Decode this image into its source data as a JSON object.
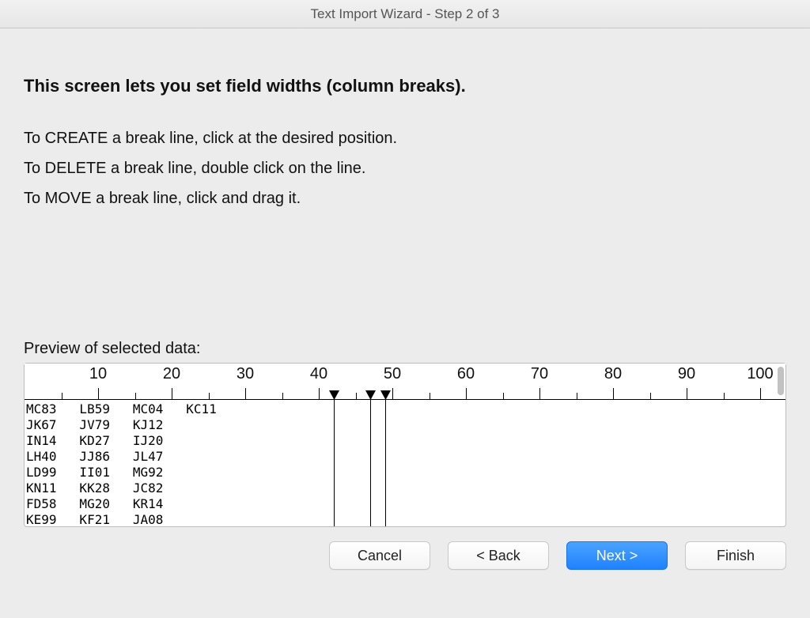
{
  "title": "Text Import Wizard - Step 2 of 3",
  "heading": "This screen lets you set field widths (column breaks).",
  "instructions": [
    "To CREATE a break line, click at the desired position.",
    "To DELETE a break line, double click on the line.",
    "To MOVE a break line, click and drag it."
  ],
  "preview_label": "Preview of selected data:",
  "ruler": {
    "major_ticks": [
      10,
      20,
      30,
      40,
      50,
      60,
      70,
      80,
      90,
      100
    ],
    "char_width": 9.3
  },
  "breaks": [
    42,
    47,
    49
  ],
  "data_rows": [
    "MC83   LB59   MC04   KC11",
    "JK67   JV79   KJ12",
    "IN14   KD27   IJ20",
    "LH40   JJ86   JL47",
    "LD99   II01   MG92",
    "KN11   KK28   JC82",
    "FD58   MG20   KR14",
    "KE99   KF21   JA08"
  ],
  "buttons": {
    "cancel": "Cancel",
    "back": "< Back",
    "next": "Next >",
    "finish": "Finish"
  }
}
